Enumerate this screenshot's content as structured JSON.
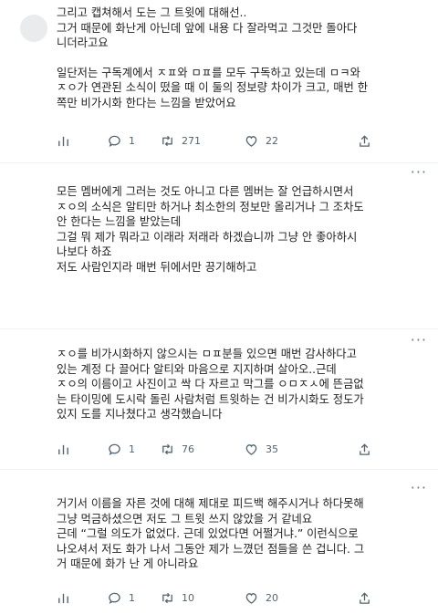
{
  "more_icon": "more-dots-icon",
  "tweets": [
    {
      "lines": [
        "그리고 캡쳐해서 도는 그 트윗에 대해선..",
        "그거 때문에 화난게 아닌데 앞에 내용 다 잘라먹고 그것만 돌아다",
        "니더라고요",
        "",
        "일단저는 구독계에서 ㅈㅍ와 ㅁㅍ를 모두 구독하고 있는데 ㅁㅋ와",
        "ㅈㅇ가 연관된 소식이 떴을 때 이 둘의 정보량 차이가 크고, 매번 한",
        "쪽만 비가시화 한다는 느낌을 받았어요"
      ],
      "stats": {
        "reply": "1",
        "retweet": "271",
        "like": "22"
      }
    },
    {
      "lines": [
        "모든 멤버에게 그러는 것도 아니고 다른 멤버는 잘 언급하시면서",
        "ㅈㅇ의 소식은 알티만 하거나 최소한의 정보만 올리거나 그 조차도",
        "안 한다는 느낌을 받았는데",
        "그걸 뭐 제가 뭐라고 이래라 저래라 하겠습니까 그냥 안 좋아하시",
        "나보다 하죠",
        "저도 사람인지라 매번 뒤에서만 끙기해하고"
      ],
      "stats": null
    },
    {
      "lines": [
        "ㅈㅇ를 비가시화하지 않으시는 ㅁㅍ분들 있으면 매번 감사하다고",
        "있는 계정 다 끌어다 알티와 마음으로 지지하며 살아오..근데",
        "ㅈㅇ의 이름이고 사진이고 싹 다 자르고 막그를 ㅇㅁㅈㅅ에 뜬금없",
        "는 타이밍에 도시락 돌린 사람처럼 트윗하는 건 비가시화도 정도가",
        "있지 도를 지나쳤다고 생각했습니다"
      ],
      "stats": {
        "reply": "1",
        "retweet": "76",
        "like": "35"
      }
    },
    {
      "lines": [
        "거기서 이름을 자른 것에 대해 제대로 피드백 해주시거나 하다못해",
        "그냥 먹금하셨으면 저도 그 트윗 쓰지 않았을 거 같네요",
        "근데 “그럴 의도가 없었다. 근데 있었다면 어쩔거냐.” 이런식으로",
        "나오셔서 저도 화가 나서 그동안 제가 느꼈던 점들을 쓴 겁니다. 그",
        "거 때문에 화가 난 게 아니라요"
      ],
      "stats": {
        "reply": "1",
        "retweet": "10",
        "like": "20"
      }
    }
  ]
}
